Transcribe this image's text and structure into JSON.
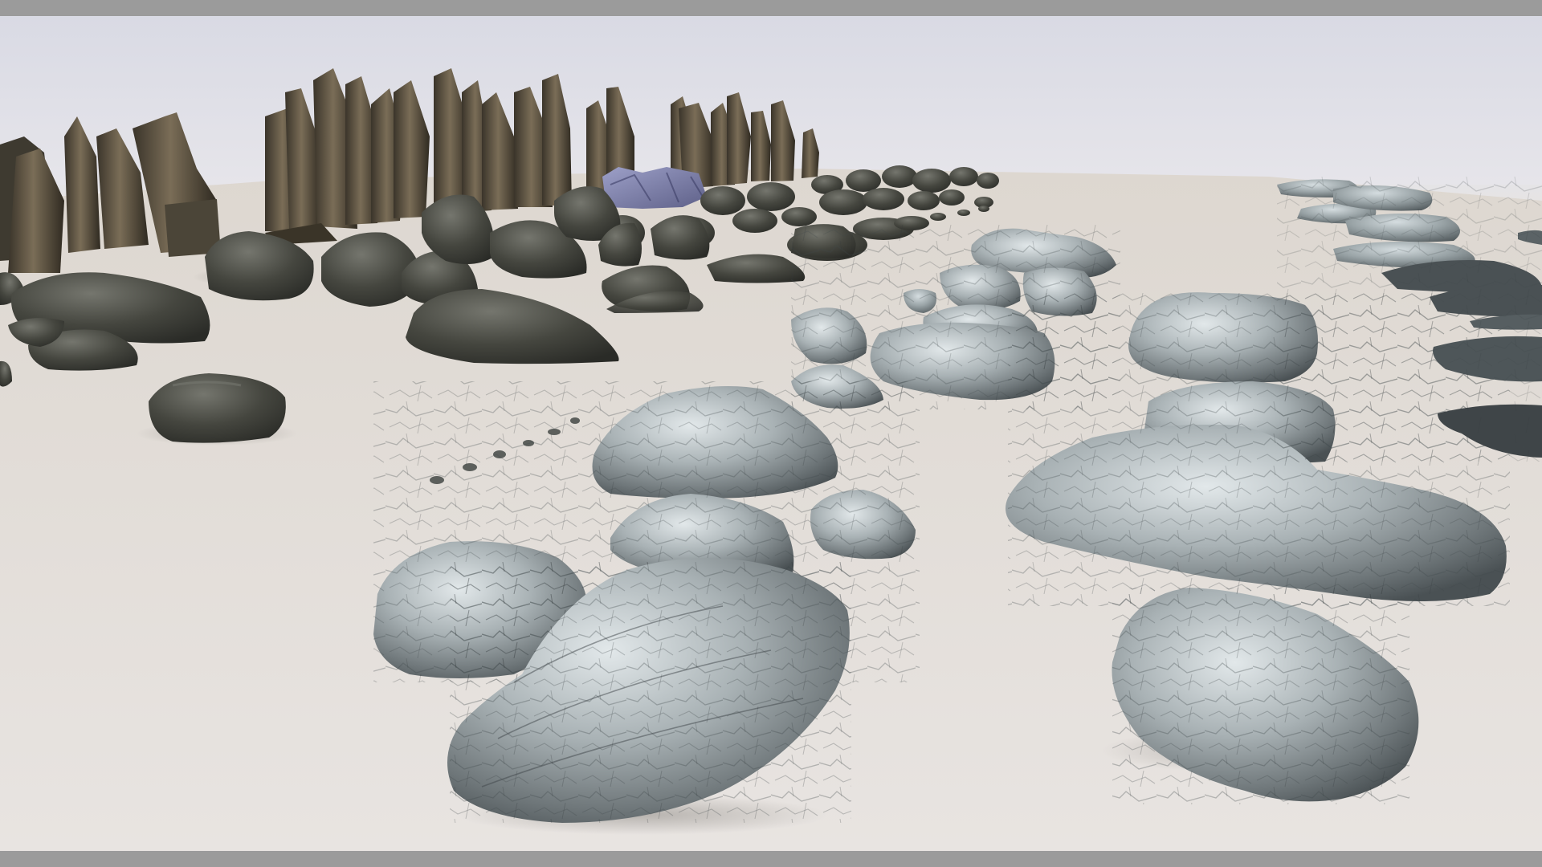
{
  "scene": {
    "sky_color": "#dcdde6",
    "ground_color": "#e4e0dc",
    "letterbox_color": "#9b9b9b",
    "rock_palette": {
      "dark_rock": "#3d3e3a",
      "dark_rock_highlight": "#6b6c64",
      "spire_rock": "#4a4336",
      "spire_highlight": "#7d705a",
      "granite_base": "#8f979b",
      "granite_highlight": "#d8dfe3",
      "granite_shadow": "#4e5558",
      "crystal": "#7e7fa8"
    }
  }
}
